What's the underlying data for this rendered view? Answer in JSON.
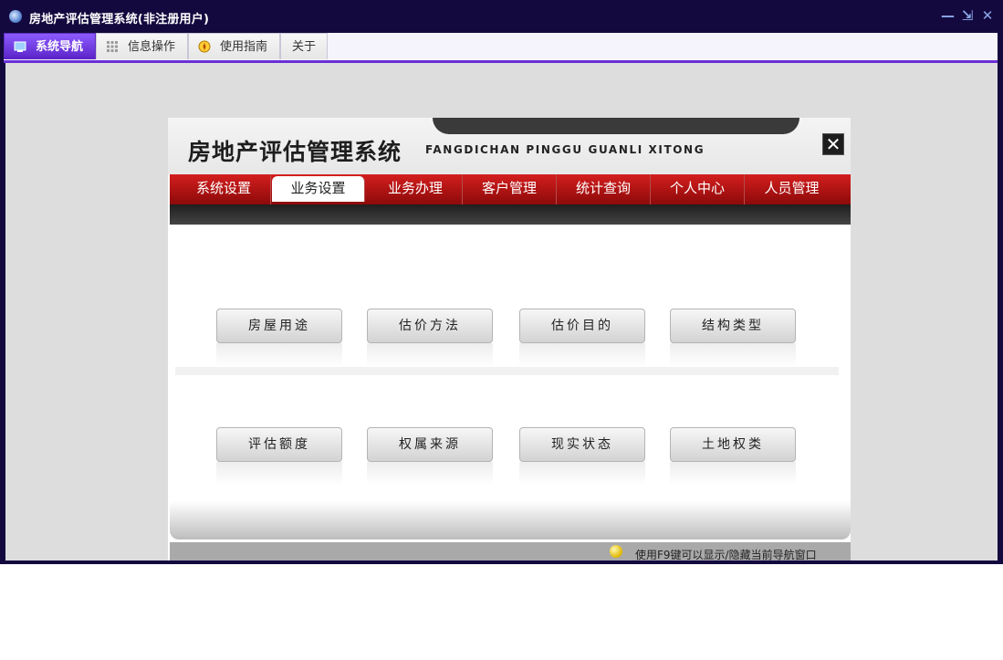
{
  "window": {
    "title": "房地产评估管理系统(非注册用户)",
    "minimize_glyph": "—",
    "restore_glyph": "⇲",
    "close_glyph": "✕"
  },
  "tabs": [
    {
      "label": "系统导航",
      "icon": "monitor-icon",
      "active": true
    },
    {
      "label": "信息操作",
      "icon": "grid-icon",
      "active": false
    },
    {
      "label": "使用指南",
      "icon": "compass-icon",
      "active": false
    },
    {
      "label": "关于",
      "icon": "",
      "active": false
    }
  ],
  "panel": {
    "title": "房地产评估管理系统",
    "subtitle": "FANGDICHAN PINGGU GUANLI XITONG",
    "close_glyph": "✕"
  },
  "menu": [
    {
      "label": "系统设置"
    },
    {
      "label": "业务设置",
      "active": true
    },
    {
      "label": "业务办理"
    },
    {
      "label": "客户管理"
    },
    {
      "label": "统计查询"
    },
    {
      "label": "个人中心"
    },
    {
      "label": "人员管理"
    }
  ],
  "buttons": {
    "row1": [
      "房屋用途",
      "估价方法",
      "估价目的",
      "结构类型"
    ],
    "row2": [
      "评估额度",
      "权属来源",
      "现实状态",
      "土地权类"
    ]
  },
  "status": {
    "text": "使用F9键可以显示/隐藏当前导航窗口"
  },
  "colors": {
    "window_bg": "#14093f",
    "tab_active": "#6a2fd6",
    "menu_red": "#c41818",
    "workarea": "#dddddd"
  }
}
